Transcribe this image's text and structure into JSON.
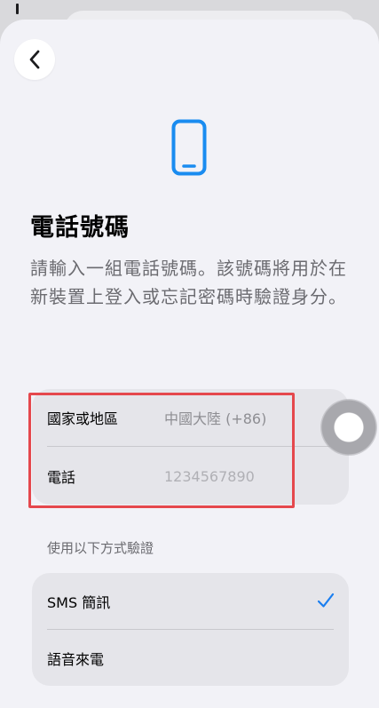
{
  "header": {
    "back_icon": "chevron-left-icon"
  },
  "hero": {
    "icon": "smartphone-icon",
    "accent_color": "#1a8cf0"
  },
  "title": "電話號碼",
  "description": "請輸入一組電話號碼。該號碼將用於在新裝置上登入或忘記密碼時驗證身分。",
  "phone_group": {
    "country_label": "國家或地區",
    "country_value": "中國大陸 (+86)",
    "phone_label": "電話",
    "phone_placeholder": "1234567890"
  },
  "verify_section": {
    "header": "使用以下方式驗證",
    "options": [
      {
        "label": "SMS 簡訊",
        "selected": true
      },
      {
        "label": "語音來電",
        "selected": false
      }
    ],
    "check_color": "#1a7ef0"
  },
  "annotation": {
    "highlight_color": "#e5484d"
  }
}
